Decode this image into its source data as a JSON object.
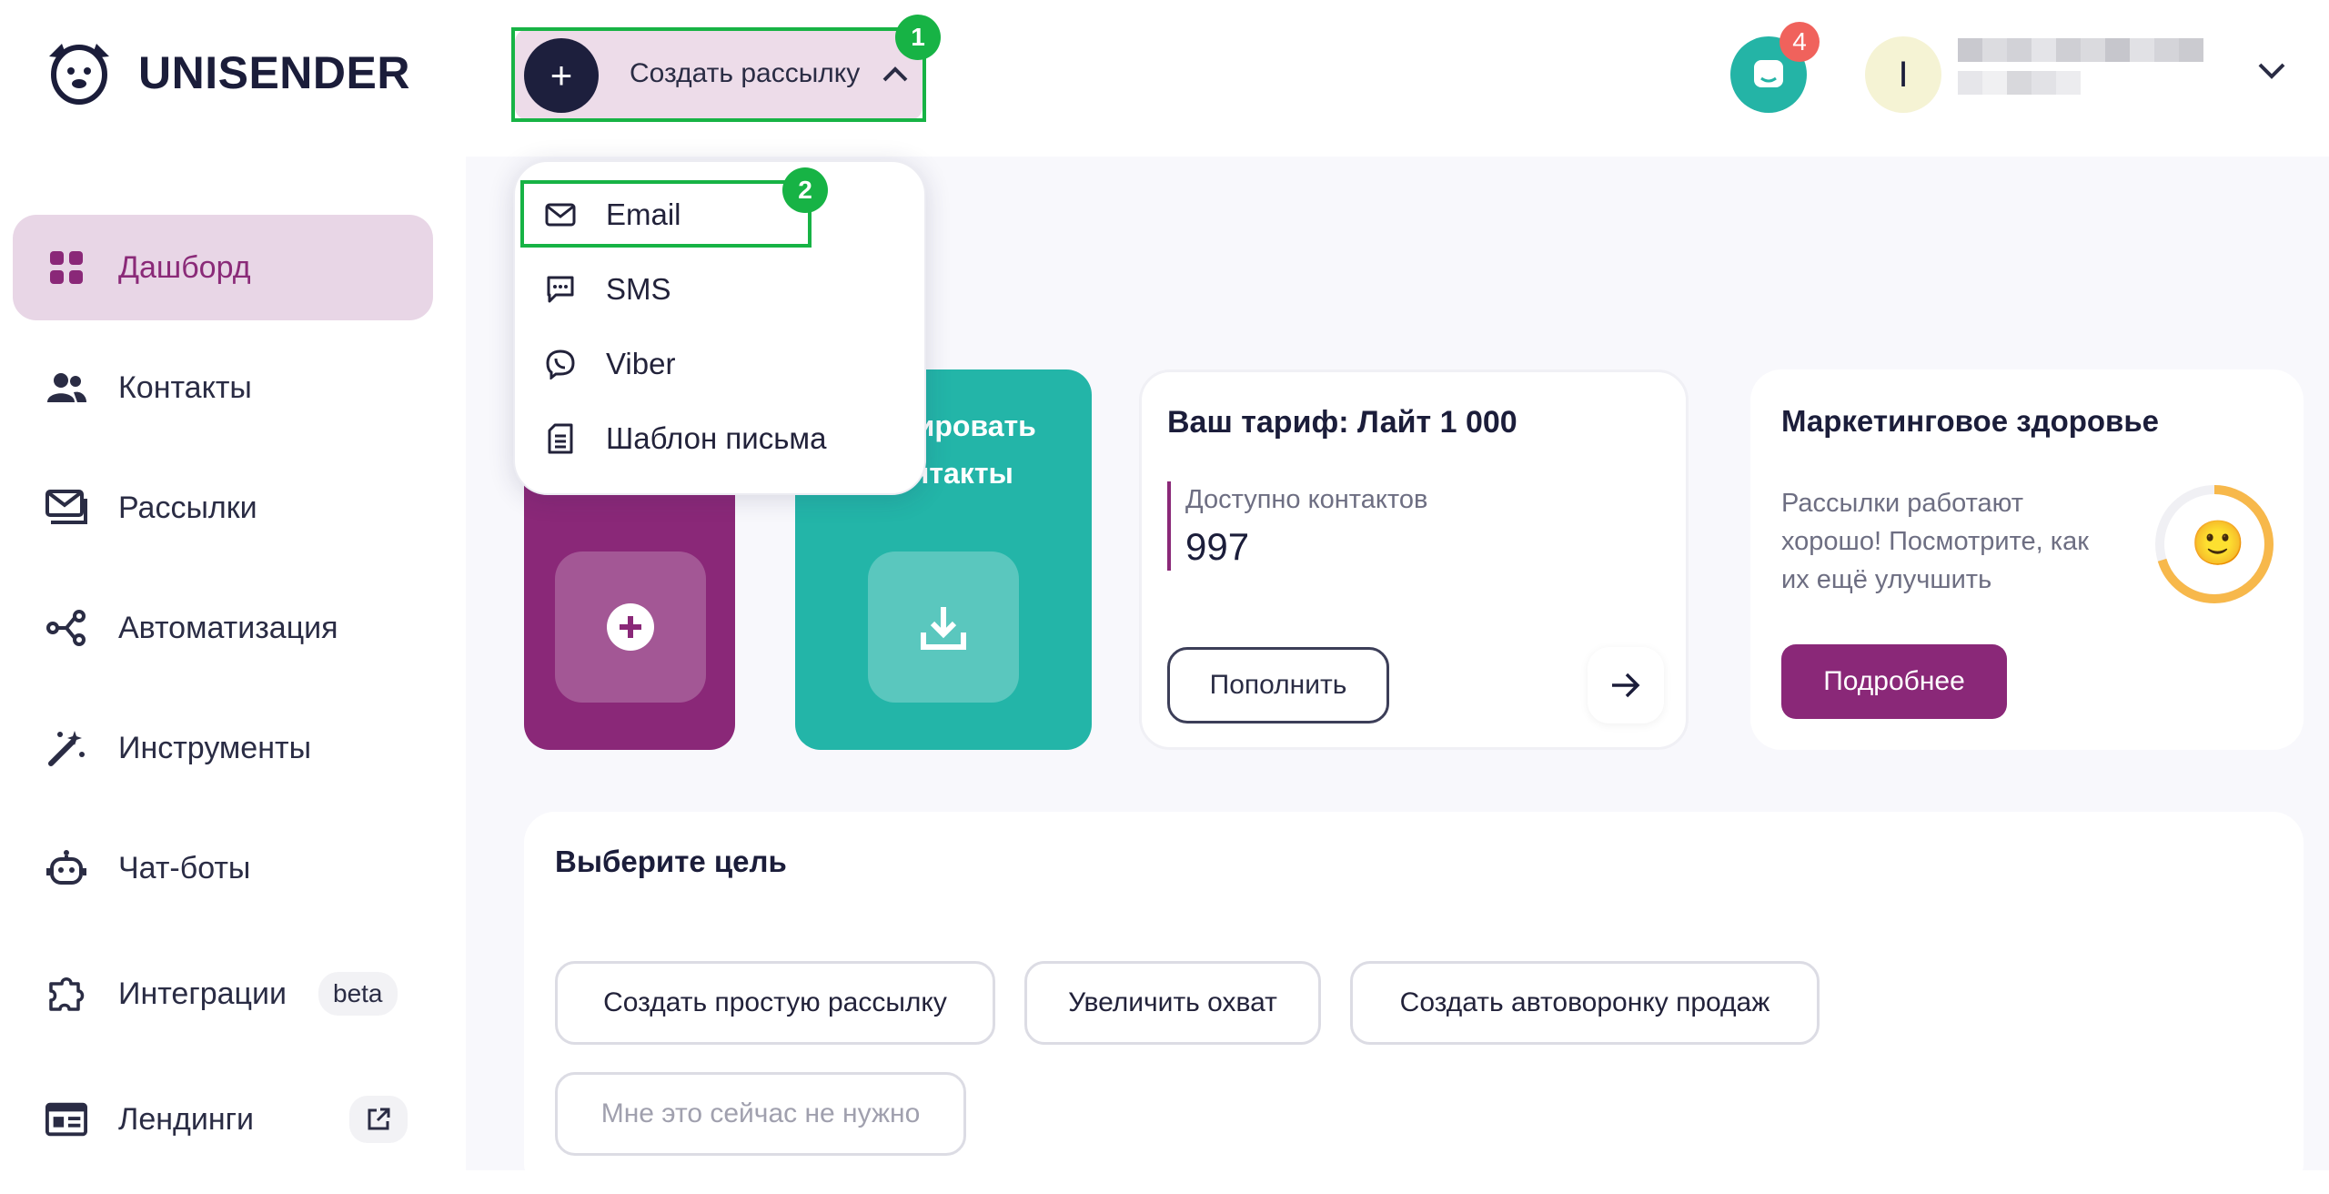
{
  "logo": {
    "text": "UNISENDER"
  },
  "sidebar": {
    "items": [
      {
        "label": "Дашборд",
        "icon": "dashboard-icon"
      },
      {
        "label": "Контакты",
        "icon": "contacts-icon"
      },
      {
        "label": "Рассылки",
        "icon": "mailings-icon"
      },
      {
        "label": "Автоматизация",
        "icon": "automation-icon"
      },
      {
        "label": "Инструменты",
        "icon": "magic-wand-icon"
      },
      {
        "label": "Чат-боты",
        "icon": "robot-icon"
      },
      {
        "label": "Интеграции",
        "icon": "puzzle-icon",
        "pill": "beta"
      },
      {
        "label": "Лендинги",
        "icon": "landing-icon"
      }
    ]
  },
  "header": {
    "create_button": "Создать рассылку",
    "highlight_1": "1",
    "chat_badge": "4",
    "avatar_letter": "I"
  },
  "dropdown": {
    "highlight_2": "2",
    "items": [
      {
        "label": "Email",
        "icon": "envelope-icon"
      },
      {
        "label": "SMS",
        "icon": "sms-icon"
      },
      {
        "label": "Viber",
        "icon": "viber-icon"
      },
      {
        "label": "Шаблон письма",
        "icon": "template-icon"
      }
    ]
  },
  "cards": {
    "import": {
      "line1": "тировать",
      "line2": "нтакты"
    },
    "tariff": {
      "title": "Ваш тариф: Лайт 1 000",
      "available_label": "Доступно контактов",
      "available_value": "997",
      "topup_button": "Пополнить"
    },
    "health": {
      "title": "Маркетинговое здоровье",
      "line1": "Рассылки работают",
      "line2": "хорошо! Посмотрите, как",
      "line3": "их ещё улучшить",
      "button": "Подробнее",
      "emoji": "🙂"
    }
  },
  "goals": {
    "title": "Выберите цель",
    "options": [
      "Создать простую рассылку",
      "Увеличить охват",
      "Создать автоворонку продаж"
    ],
    "skip": "Мне это сейчас не нужно"
  },
  "colors": {
    "brand_purple": "#8a2878",
    "teal": "#23b5a8",
    "highlight_green": "#17b345"
  }
}
